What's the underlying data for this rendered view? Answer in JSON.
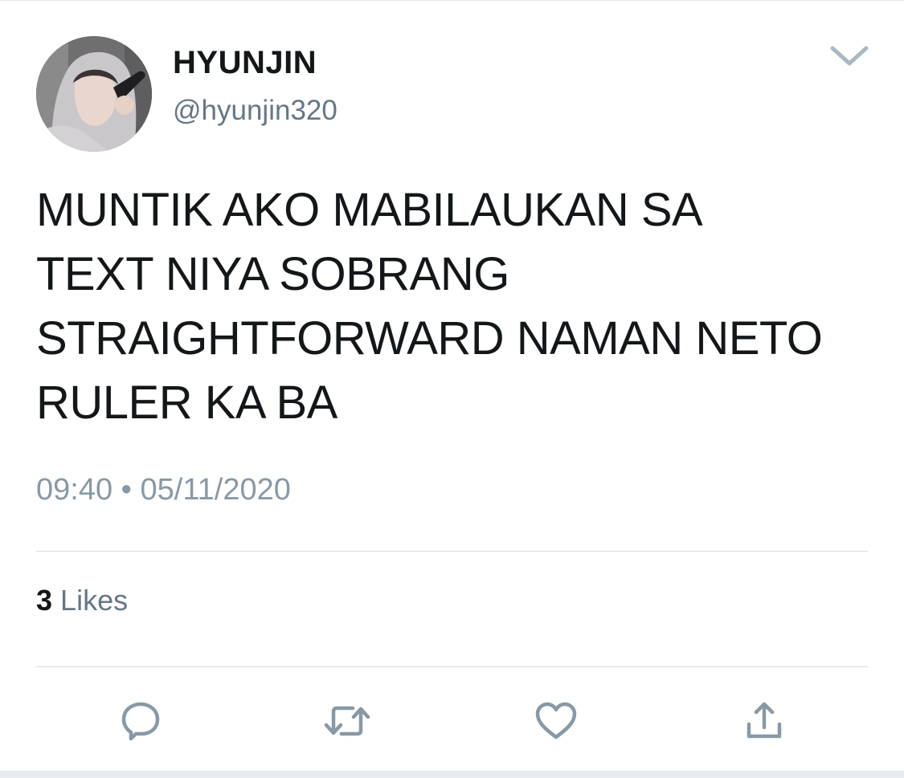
{
  "tweet": {
    "author": {
      "display_name": "HYUNJIN",
      "handle": "@hyunjin320"
    },
    "text": "MUNTIK AKO MABILAUKAN SA\nTEXT NIYA SOBRANG\nSTRAIGHTFORWARD NAMAN NETO\nRULER KA BA",
    "timestamp": "09:40 • 05/11/2020",
    "stats": {
      "likes_count": "3",
      "likes_label": "Likes"
    },
    "actions": [
      {
        "name": "reply",
        "icon": "reply-icon"
      },
      {
        "name": "retweet",
        "icon": "retweet-icon"
      },
      {
        "name": "like",
        "icon": "heart-icon"
      },
      {
        "name": "share",
        "icon": "share-icon"
      }
    ],
    "menu_icon": "chevron-down-icon"
  },
  "colors": {
    "text_primary": "#14171a",
    "text_secondary": "#657786",
    "timestamp": "#8899a6",
    "icon": "#8899a6",
    "divider": "#d3dadf"
  }
}
